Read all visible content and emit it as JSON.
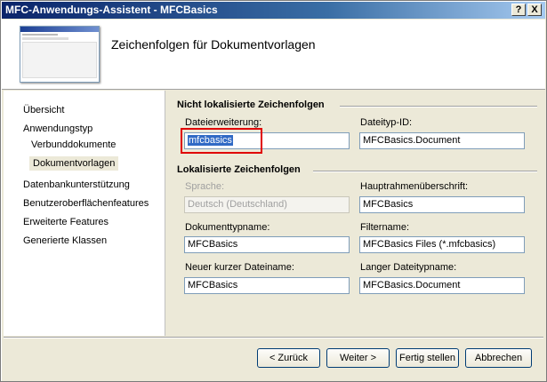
{
  "window": {
    "title": "MFC-Anwendungs-Assistent - MFCBasics",
    "help_label": "?",
    "close_label": "X"
  },
  "header": {
    "title": "Zeichenfolgen für Dokumentvorlagen"
  },
  "sidebar": {
    "items": [
      {
        "label": "Übersicht"
      },
      {
        "label": "Anwendungstyp"
      },
      {
        "label": "Verbunddokumente"
      },
      {
        "label": "Dokumentvorlagen"
      },
      {
        "label": "Datenbankunterstützung"
      },
      {
        "label": "Benutzeroberflächenfeatures"
      },
      {
        "label": "Erweiterte Features"
      },
      {
        "label": "Generierte Klassen"
      }
    ],
    "selected": "Dokumentvorlagen"
  },
  "nonlocalized": {
    "heading": "Nicht lokalisierte Zeichenfolgen",
    "file_extension": {
      "label": "Dateierweiterung:",
      "value": "mfcbasics"
    },
    "filetype_id": {
      "label": "Dateityp-ID:",
      "value": "MFCBasics.Document"
    }
  },
  "localized": {
    "heading": "Lokalisierte Zeichenfolgen",
    "language": {
      "label": "Sprache:",
      "value": "Deutsch (Deutschland)"
    },
    "main_frame_caption": {
      "label": "Hauptrahmenüberschrift:",
      "value": "MFCBasics"
    },
    "doc_type_name": {
      "label": "Dokumenttypname:",
      "value": "MFCBasics"
    },
    "filter_name": {
      "label": "Filtername:",
      "value": "MFCBasics Files (*.mfcbasics)"
    },
    "short_file_name": {
      "label": "Neuer kurzer Dateiname:",
      "value": "MFCBasics"
    },
    "long_file_type": {
      "label": "Langer Dateitypname:",
      "value": "MFCBasics.Document"
    }
  },
  "buttons": {
    "back": "< Zurück",
    "next": "Weiter >",
    "finish": "Fertig stellen",
    "cancel": "Abbrechen"
  }
}
